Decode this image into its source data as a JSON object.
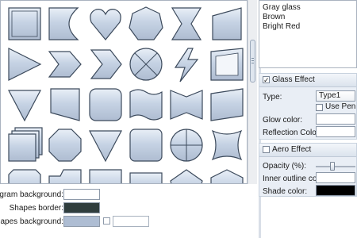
{
  "fill_color": "#c6d3e4",
  "stroke_color": "#3c4a5c",
  "shape_rows": [
    [
      "square-shape",
      "half-moon-shape",
      "heart-shape",
      "heptagon-shape",
      "hourglass-shape",
      "trapezoid-shape"
    ],
    [
      "triangle-right-shape",
      "notched-arrow-shape",
      "chevron-shape",
      "circle-cross-shape",
      "lightning-shape",
      "frame-shape"
    ],
    [
      "triangle-down-shape",
      "trapezoid-down-shape",
      "rounded-square-shape",
      "wave-shape",
      "bowtie-shape",
      "tilted-banner-shape"
    ],
    [
      "stacked-squares-shape",
      "octagon-shape",
      "triangle-down-shape-2",
      "rounded-square-shape-2",
      "circle-quarters-shape",
      "concave-square-shape"
    ],
    [
      "notched-square-shape",
      "tab-shape",
      "cut-corner-shape",
      "bar-shape",
      "pentagon-shape",
      "hexagon-shape"
    ]
  ],
  "bottom": {
    "diagram_background_label": "Diagram background:",
    "diagram_background_color": "#ffffff",
    "shapes_border_label": "Shapes border:",
    "shapes_border_color": "#2f3d3d",
    "shapes_background_label": "Shapes background:",
    "shapes_background_color": "#aebdd3"
  },
  "right": {
    "list_items": [
      "Gray glass",
      "Brown",
      "Bright Red"
    ],
    "glass_effect": {
      "title": "Glass Effect",
      "checked": true,
      "check_mark": "✓",
      "type_label": "Type:",
      "type_value": "Type1",
      "use_pen_label": "Use Pen as G",
      "glow_label": "Glow color:",
      "reflection_label": "Reflection Color:"
    },
    "aero_effect": {
      "title": "Aero Effect",
      "checked": false,
      "opacity_label": "Opacity (%):",
      "opacity_fraction": 0.42,
      "inner_outline_label": "Inner outline color:",
      "shade_label": "Shade color:",
      "shade_color": "#000000"
    }
  }
}
